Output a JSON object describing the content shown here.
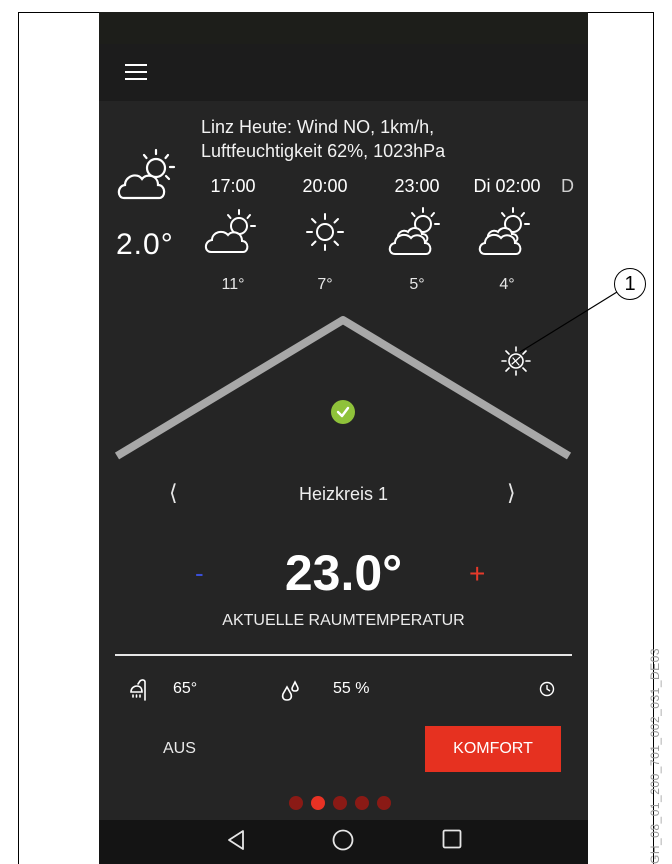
{
  "weather": {
    "summary_line1": "Linz Heute: Wind NO, 1km/h,",
    "summary_line2": "Luftfeuchtigkeit 62%, 1023hPa",
    "current_temp": "2.0°",
    "current_icon": "partly-cloudy-icon",
    "forecast": [
      {
        "time": "17:00",
        "temp": "11°",
        "icon": "partly-cloudy-icon"
      },
      {
        "time": "20:00",
        "temp": "7°",
        "icon": "sun-icon"
      },
      {
        "time": "23:00",
        "temp": "5°",
        "icon": "cloudy-sun-icon"
      },
      {
        "time": "Di 02:00",
        "temp": "4°",
        "icon": "cloudy-sun-icon"
      }
    ],
    "forecast_partial": "D"
  },
  "heating": {
    "circuit_name": "Heizkreis 1",
    "prev_symbol": "⟨",
    "next_symbol": "⟩",
    "minus_symbol": "-",
    "plus_symbol": "+",
    "temperature": "23.0°",
    "temperature_label": "AKTUELLE RAUMTEMPERATUR",
    "status_icon": "check-icon",
    "widget_icon": "sun-gear-icon"
  },
  "info": {
    "hot_water_temp": "65°",
    "humidity": "55 %",
    "shower_icon": "shower-icon",
    "humidity_icon": "droplets-icon",
    "clock_icon": "clock-icon"
  },
  "modes": {
    "off_label": "AUS",
    "comfort_label": "KOMFORT"
  },
  "pager": {
    "count": 5,
    "active_index": 1
  },
  "callout": {
    "number": "1"
  },
  "doc_code": "GH_08_01_200_701_002_031_DE03",
  "colors": {
    "background": "#252525",
    "accent_red": "#e63120",
    "check_green": "#8fc23a",
    "minus_blue": "#3a4fd8"
  }
}
